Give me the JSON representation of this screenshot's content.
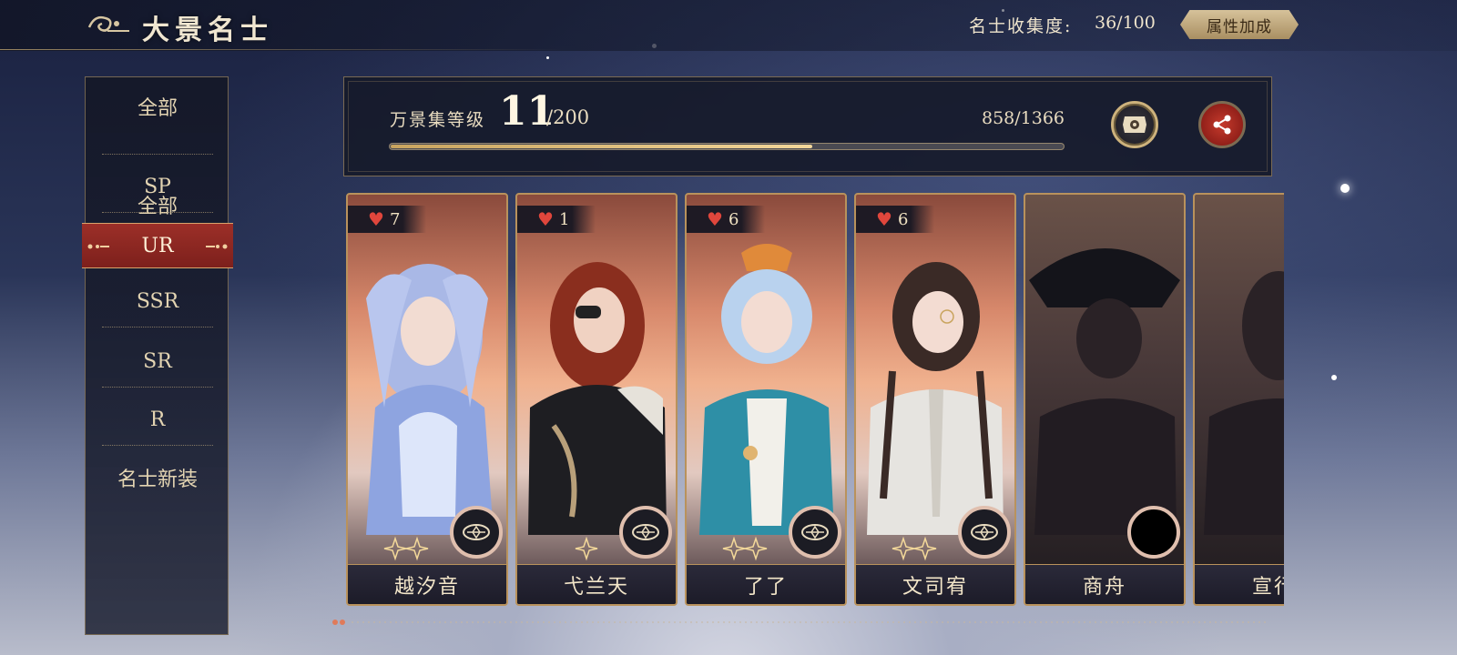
{
  "header": {
    "title": "大景名士",
    "collection_label": "名士收集度:",
    "collection_value": "36/100",
    "attribute_button": "属性加成"
  },
  "sidebar": {
    "items": [
      {
        "label": "全部"
      },
      {
        "label": "SP"
      },
      {
        "label": "UR",
        "active": true
      },
      {
        "label": "SSR"
      },
      {
        "label": "SR"
      },
      {
        "label": "R"
      },
      {
        "label": "名士新装"
      }
    ]
  },
  "level_panel": {
    "label": "万景集等级",
    "level": "11",
    "level_max": "/200",
    "exp_text": "858/1366",
    "exp_progress": 0.628
  },
  "cards": [
    {
      "name": "越汐音",
      "favor": "7",
      "owned": true,
      "palette": "blue"
    },
    {
      "name": "弋兰天",
      "favor": "1",
      "owned": true,
      "palette": "black"
    },
    {
      "name": "了了",
      "favor": "6",
      "owned": true,
      "palette": "teal"
    },
    {
      "name": "文司宥",
      "favor": "6",
      "owned": true,
      "palette": "white"
    },
    {
      "name": "商舟",
      "favor": "",
      "owned": false,
      "palette": "shadow"
    },
    {
      "name": "宣行",
      "favor": "",
      "owned": false,
      "palette": "shadow"
    }
  ],
  "colors": {
    "accent_gold": "#b9925c",
    "active_red": "#9c2f28",
    "heart_red": "#e0463c"
  }
}
